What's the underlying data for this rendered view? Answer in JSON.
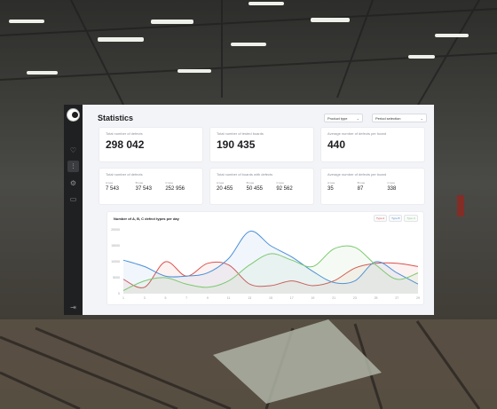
{
  "app": {
    "title": "Statistics"
  },
  "header": {
    "product_type": "Product type",
    "period_selection": "Period selection"
  },
  "sidebar": {
    "icons": [
      "home-icon",
      "chart-icon",
      "settings-icon",
      "folder-icon",
      "logout-icon"
    ],
    "active": "chart-icon"
  },
  "kpis": [
    {
      "label": "Total number of defects",
      "value": "298 042"
    },
    {
      "label": "Total number of tested boards",
      "value": "190 435"
    },
    {
      "label": "Average number of defects per board",
      "value": "440"
    }
  ],
  "breakdowns": [
    {
      "label": "Total number of defects",
      "items": [
        {
          "label": "A type",
          "value": "7 543"
        },
        {
          "label": "B type",
          "value": "37 543"
        },
        {
          "label": "C type",
          "value": "252 956"
        }
      ]
    },
    {
      "label": "Total number of boards with defects",
      "items": [
        {
          "label": "A type",
          "value": "20 455"
        },
        {
          "label": "B type",
          "value": "50 455"
        },
        {
          "label": "C type",
          "value": "92 562"
        }
      ]
    },
    {
      "label": "Average number of defects per board",
      "items": [
        {
          "label": "A type",
          "value": "35"
        },
        {
          "label": "B type",
          "value": "87"
        },
        {
          "label": "C type",
          "value": "338"
        }
      ]
    }
  ],
  "chart_data": {
    "type": "area",
    "title": "Number of A, B, C defect types per day",
    "x": [
      1,
      3,
      5,
      7,
      9,
      11,
      13,
      15,
      17,
      19,
      21,
      23,
      25,
      27,
      29
    ],
    "yticks": [
      0,
      5000,
      10000,
      15000,
      20000
    ],
    "ylim": [
      0,
      20000
    ],
    "legend_placement": "top-right",
    "grid": false,
    "series": [
      {
        "name": "Type A",
        "color": "#d9534f",
        "values": [
          4500,
          2000,
          10000,
          5500,
          9500,
          9000,
          3000,
          2500,
          4000,
          2500,
          4000,
          8000,
          9500,
          9500,
          8500
        ]
      },
      {
        "name": "Type B",
        "color": "#4a90d9",
        "values": [
          10500,
          8500,
          5500,
          5500,
          6500,
          11000,
          19500,
          15000,
          11500,
          7000,
          3500,
          4000,
          10000,
          6500,
          3000
        ]
      },
      {
        "name": "Type C",
        "color": "#7cc96f",
        "values": [
          1000,
          4000,
          5000,
          3000,
          2000,
          4000,
          9000,
          12500,
          10500,
          8500,
          14000,
          14500,
          9000,
          4500,
          6500
        ]
      }
    ]
  }
}
